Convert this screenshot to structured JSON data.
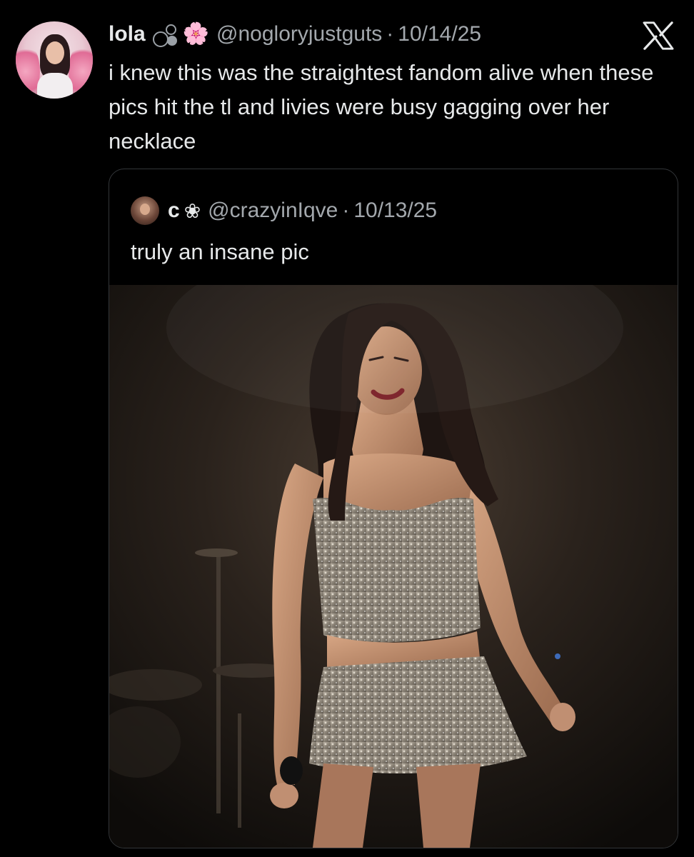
{
  "tweet": {
    "author_name": "lola",
    "author_handle": "@nogloryjustguts",
    "separator": "·",
    "date": "10/14/25",
    "text": "i knew this was the straightest fandom alive when these pics hit the tl and livies were busy gagging over her necklace",
    "emoji_flower": "🌸"
  },
  "quoted_tweet": {
    "author_name": "c",
    "flower_symbol": "❀",
    "author_handle": "@crazyinIqve",
    "separator": "·",
    "date": "10/13/25",
    "text": "truly an insane pic"
  },
  "brand": {
    "logo_icon": "x-logo-icon",
    "color": "#e7e9ea"
  },
  "colors": {
    "background": "#000000",
    "text": "#e7e9ea",
    "muted": "#a3a8ad",
    "border": "#333639"
  }
}
